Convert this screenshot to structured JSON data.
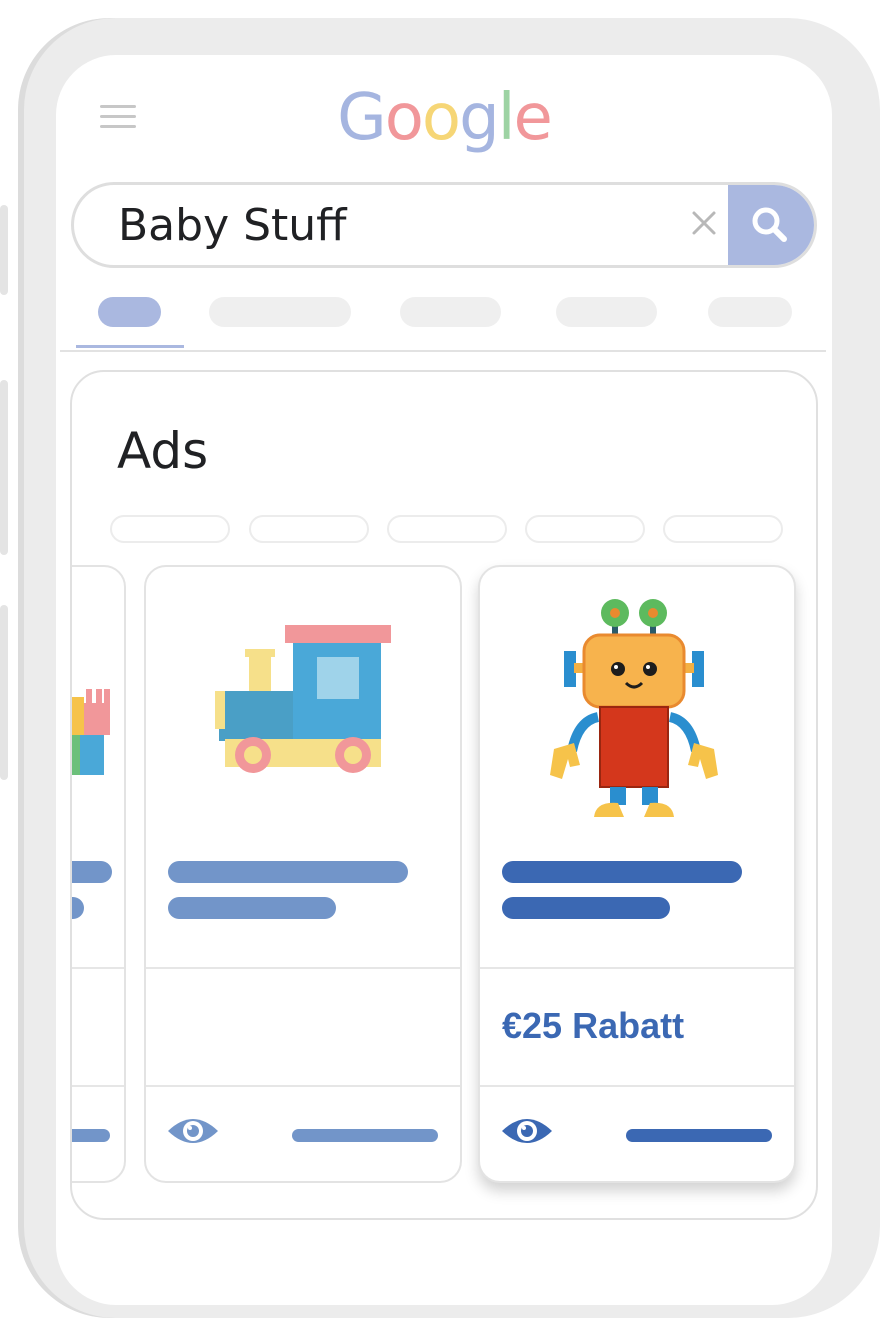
{
  "header": {
    "logo_letters": [
      "G",
      "o",
      "o",
      "g",
      "l",
      "e"
    ],
    "logo_colors": [
      "#a5b5e0",
      "#f1979a",
      "#f6d676",
      "#a5b5e0",
      "#9dd3a3",
      "#f1979a"
    ]
  },
  "search": {
    "query": "Baby Stuff"
  },
  "icons": {
    "menu": "hamburger-menu-icon",
    "clear": "close-icon",
    "search": "search-icon",
    "view": "eye-icon"
  },
  "tabs": {
    "active_index": 0,
    "count": 5
  },
  "ads": {
    "title": "Ads",
    "chip_count": 5,
    "products": [
      {
        "image": "toy-blocks",
        "discount": ""
      },
      {
        "image": "toy-train",
        "discount": ""
      },
      {
        "image": "toy-robot",
        "discount": "€25 Rabatt",
        "featured": true
      }
    ]
  },
  "colors": {
    "accent": "#aab8e0",
    "link_light": "#7295c9",
    "link_dark": "#3b68b3",
    "frame": "#ececec"
  }
}
